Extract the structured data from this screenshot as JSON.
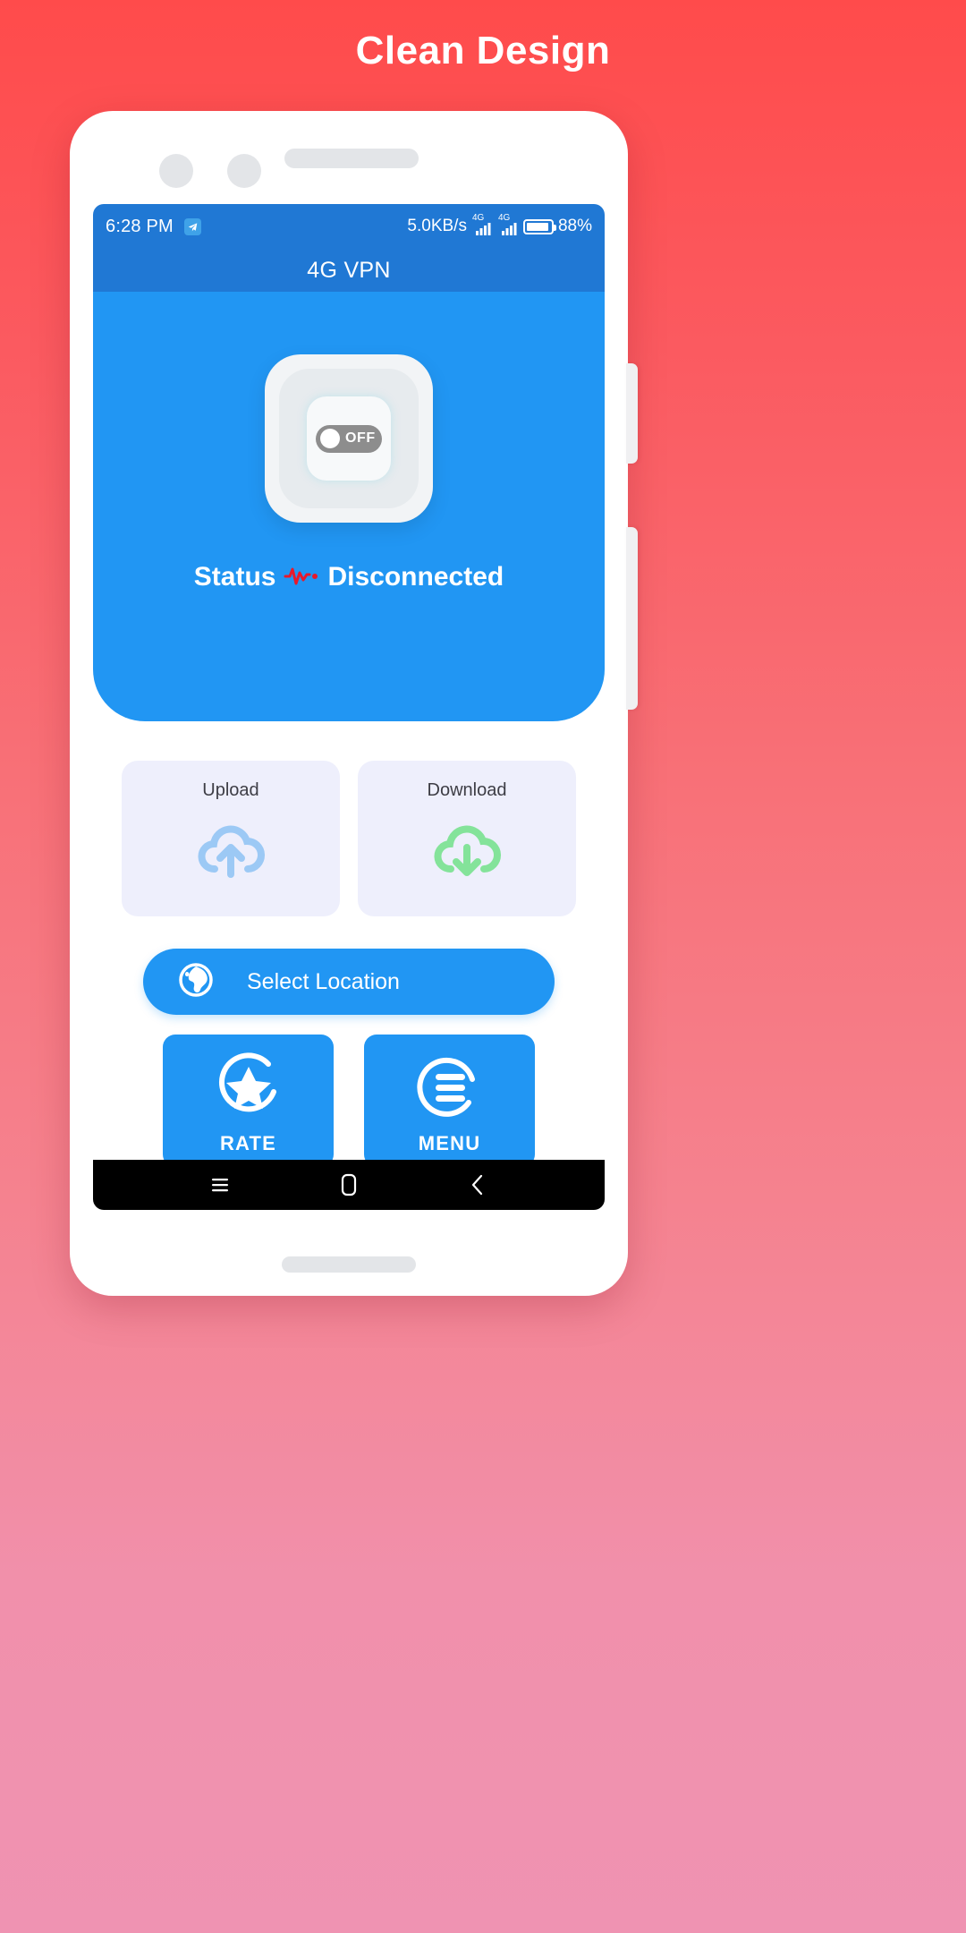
{
  "headline": "Clean Design",
  "colors": {
    "bg_top": "#FF4B4B",
    "bg_bottom": "#EF93B2",
    "accent_blue": "#2196F3",
    "statusbar_blue": "#2078D4",
    "card_bg": "#EEEFFC",
    "upload_icon": "#9CC9F5",
    "download_icon": "#84E39A",
    "toggle_pill": "#8D8D8D",
    "pulse_red": "#E8192B"
  },
  "statusbar": {
    "time": "6:28 PM",
    "app_icon": "➤",
    "speed": "5.0KB/s",
    "signal_1_label": "4G",
    "signal_2_label": "4G",
    "battery_percent": "88%"
  },
  "appbar": {
    "title": "4G VPN"
  },
  "hero": {
    "toggle_state_label": "OFF",
    "status_prefix": "Status",
    "status_value": "Disconnected"
  },
  "cards": [
    {
      "title": "Upload",
      "icon": "cloud-upload-icon",
      "color": "#9CC9F5"
    },
    {
      "title": "Download",
      "icon": "cloud-download-icon",
      "color": "#84E39A"
    }
  ],
  "select_location": {
    "label": "Select Location",
    "icon": "globe-icon"
  },
  "actions": [
    {
      "label": "RATE",
      "icon": "star-circle-icon"
    },
    {
      "label": "MENU",
      "icon": "menu-circle-icon"
    }
  ],
  "navbar": {
    "recents": "recents-icon",
    "home": "home-icon",
    "back": "back-icon"
  }
}
